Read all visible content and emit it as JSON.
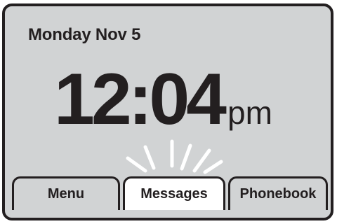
{
  "status": {
    "date": "Monday Nov 5"
  },
  "clock": {
    "time": "12:04",
    "period": "pm"
  },
  "softkeys": {
    "left": "Menu",
    "center": "Messages",
    "right": "Phonebook"
  },
  "colors": {
    "screen_background": "#d1d3d4",
    "text": "#231f20",
    "highlight": "#ffffff"
  }
}
